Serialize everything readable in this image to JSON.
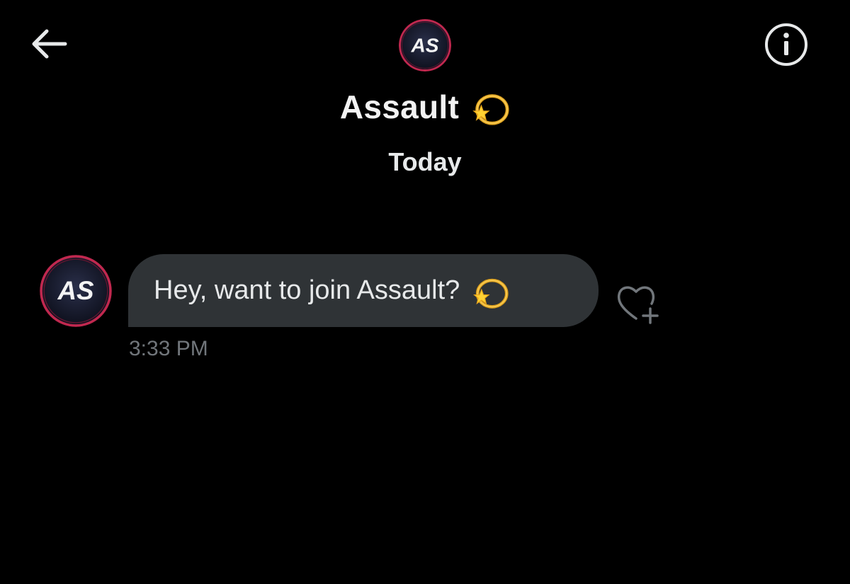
{
  "header": {
    "title": "Assault",
    "title_emoji": "dizzy-emoji",
    "avatar_text": "AS",
    "back_icon": "arrow-left-icon",
    "info_icon": "info-circle-icon"
  },
  "conversation": {
    "date_separator": "Today",
    "messages": [
      {
        "text": "Hey, want to join Assault?",
        "emoji": "dizzy-emoji",
        "time": "3:33 PM",
        "avatar_text": "AS"
      }
    ],
    "react_icon": "heart-plus-icon"
  },
  "colors": {
    "background": "#000000",
    "bubble": "#2f3336",
    "text_primary": "#e7e9ea",
    "text_secondary": "#71767b",
    "avatar_ring": "#c0284f"
  }
}
